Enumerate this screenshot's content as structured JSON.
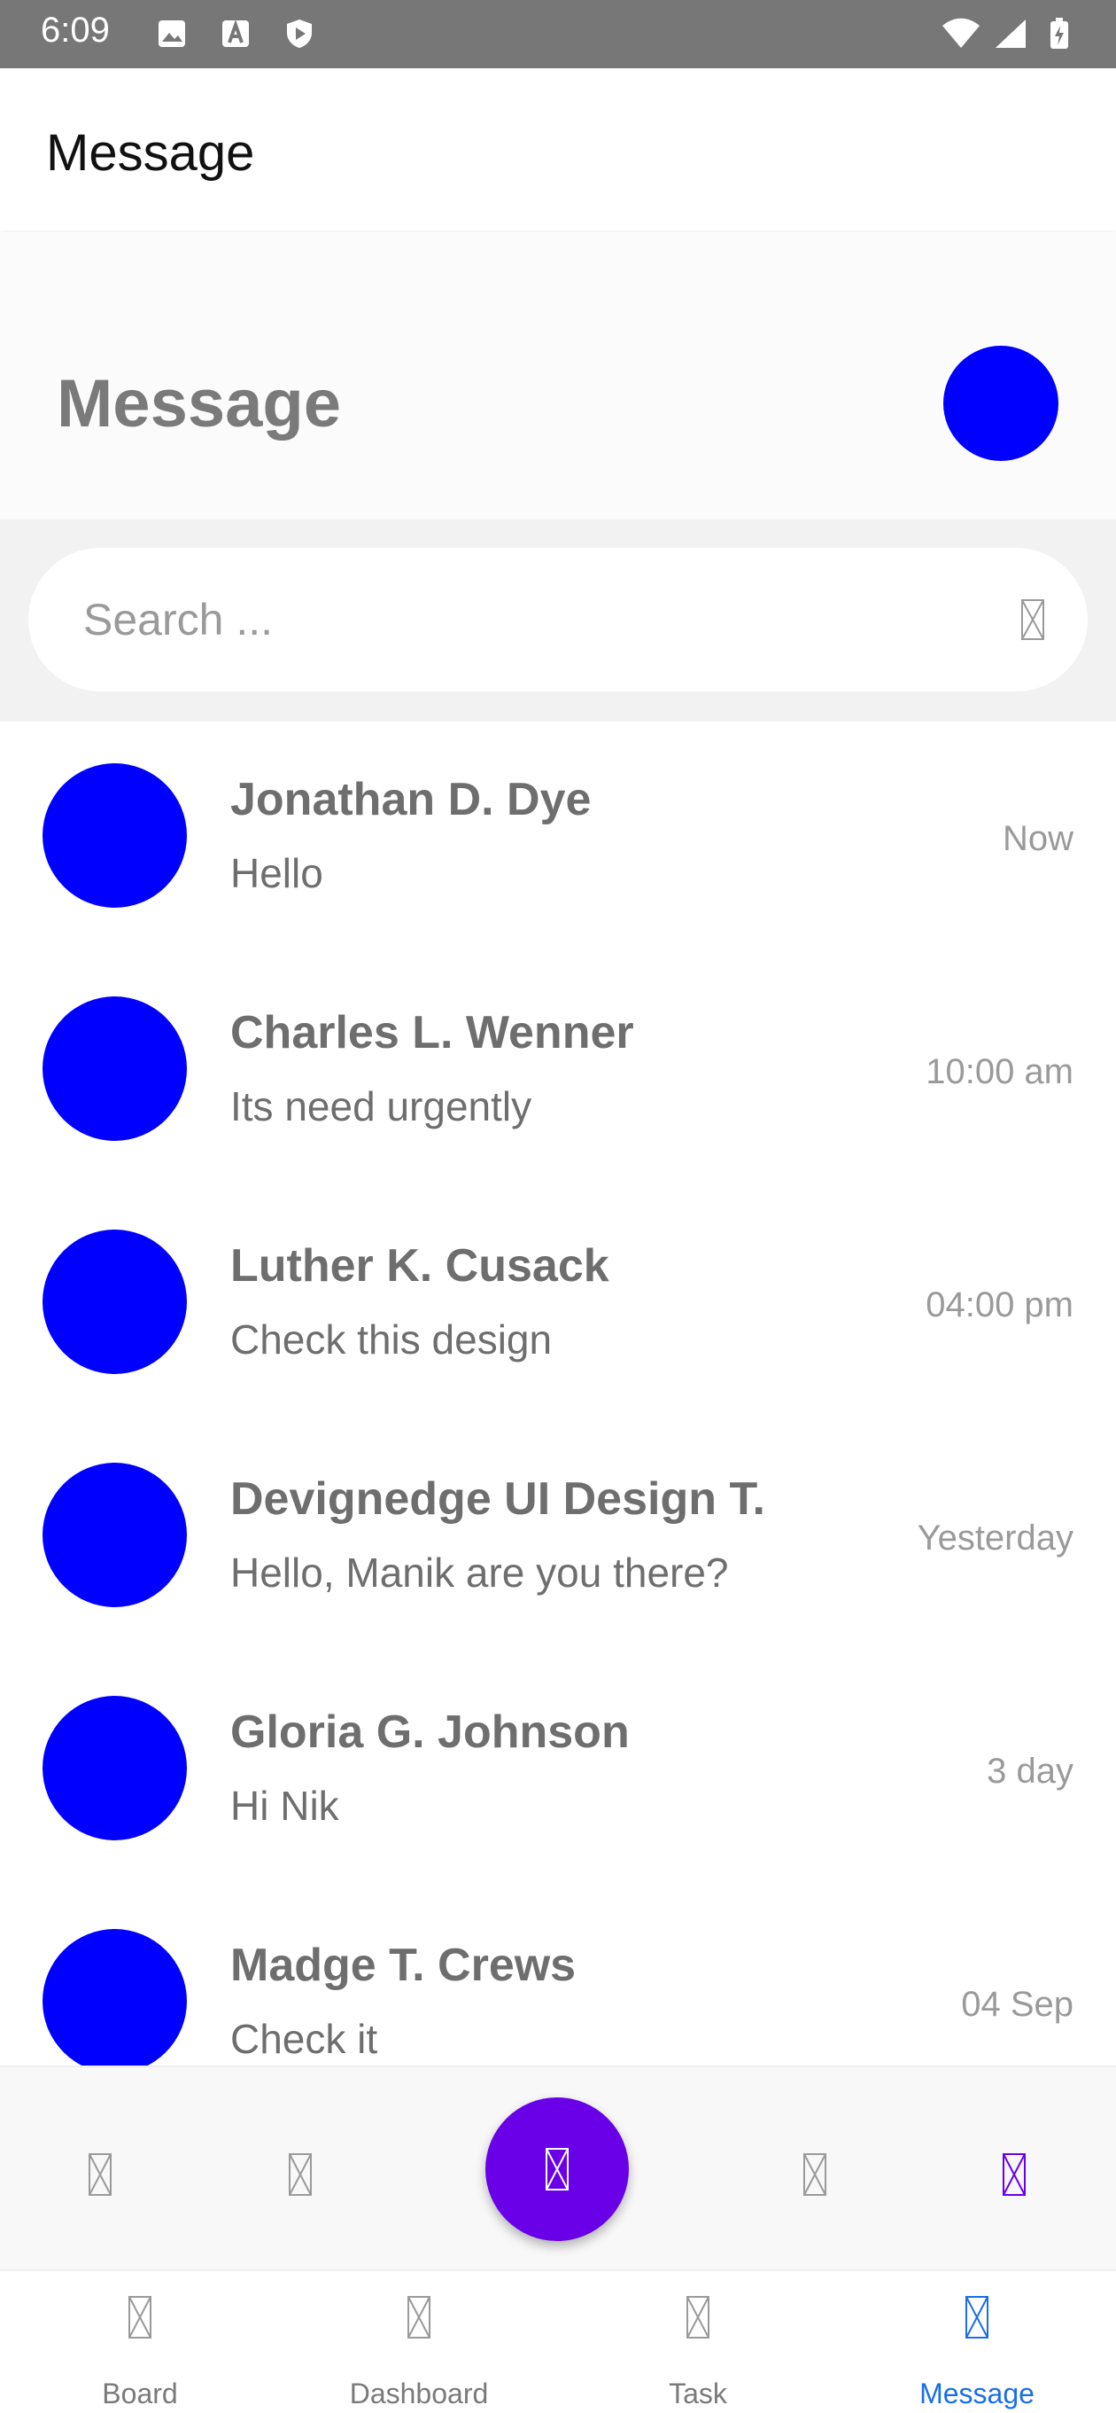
{
  "status_bar": {
    "time": "6:09",
    "left_icons": [
      "image-icon",
      "text-a-icon",
      "shield-play-icon"
    ],
    "right_icons": [
      "wifi-icon",
      "signal-icon",
      "battery-charging-icon"
    ]
  },
  "app_bar": {
    "title": "Message"
  },
  "header": {
    "title": "Message"
  },
  "search": {
    "placeholder": "Search ...",
    "icon": "search-icon"
  },
  "messages": [
    {
      "name": "Jonathan D. Dye",
      "message": "Hello",
      "time": "Now"
    },
    {
      "name": "Charles L. Wenner",
      "message": "Its need urgently",
      "time": "10:00 am"
    },
    {
      "name": "Luther K. Cusack",
      "message": "Check this design",
      "time": "04:00 pm"
    },
    {
      "name": "Devignedge UI Design T.",
      "message": "Hello, Manik are you there?",
      "time": "Yesterday"
    },
    {
      "name": "Gloria G. Johnson",
      "message": "Hi Nik",
      "time": "3 day"
    },
    {
      "name": "Madge T. Crews",
      "message": "Check it",
      "time": "04 Sep"
    }
  ],
  "bottom_icons": [
    "home-icon",
    "folder-icon",
    "add-icon",
    "calendar-icon",
    "chat-icon"
  ],
  "tabs": [
    {
      "label": "Board",
      "icon": "board-icon"
    },
    {
      "label": "Dashboard",
      "icon": "dashboard-icon"
    },
    {
      "label": "Task",
      "icon": "task-icon"
    },
    {
      "label": "Message",
      "icon": "message-icon"
    }
  ],
  "colors": {
    "avatar": "#0000ff",
    "fab": "#6a00e8",
    "active_tab": "#1a6ee8",
    "active_icon": "#6a00e8"
  }
}
